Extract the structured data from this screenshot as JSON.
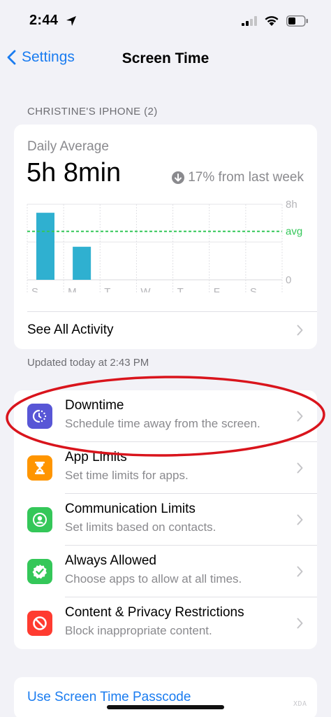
{
  "status_bar": {
    "time": "2:44"
  },
  "nav": {
    "back_label": "Settings",
    "title": "Screen Time"
  },
  "device_header": "CHRISTINE'S IPHONE (2)",
  "usage": {
    "daily_label": "Daily Average",
    "daily_value": "5h 8min",
    "change_text": "17% from last week",
    "see_all_label": "See All Activity",
    "updated_text": "Updated today at 2:43 PM"
  },
  "chart_data": {
    "type": "bar",
    "categories": [
      "S",
      "M",
      "T",
      "W",
      "T",
      "F",
      "S"
    ],
    "values": [
      7.1,
      3.5,
      0,
      0,
      0,
      0,
      0
    ],
    "ylim": [
      0,
      8
    ],
    "y_ticks": [
      "8h",
      "0"
    ],
    "avg_label": "avg",
    "avg_value": 5.13,
    "bar_color": "#2fb0d0",
    "avg_color": "#34c759"
  },
  "settings": [
    {
      "title": "Downtime",
      "subtitle": "Schedule time away from the screen.",
      "icon": "downtime-icon",
      "color": "#5856d6"
    },
    {
      "title": "App Limits",
      "subtitle": "Set time limits for apps.",
      "icon": "hourglass-icon",
      "color": "#ff9500"
    },
    {
      "title": "Communication Limits",
      "subtitle": "Set limits based on contacts.",
      "icon": "contact-icon",
      "color": "#34c759"
    },
    {
      "title": "Always Allowed",
      "subtitle": "Choose apps to allow at all times.",
      "icon": "checkmark-badge-icon",
      "color": "#34c759"
    },
    {
      "title": "Content & Privacy Restrictions",
      "subtitle": "Block inappropriate content.",
      "icon": "no-entry-icon",
      "color": "#ff3b30"
    }
  ],
  "passcode_label": "Use Screen Time Passcode",
  "watermark": "XDA"
}
